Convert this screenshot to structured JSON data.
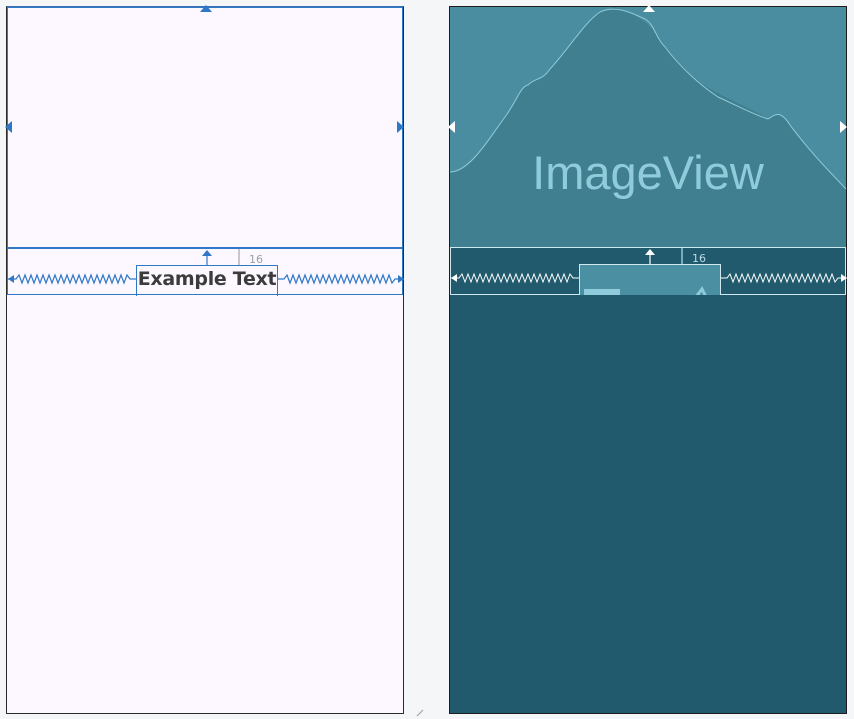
{
  "design_view": {
    "textview": {
      "text": "Example Text"
    },
    "top_margin": "16",
    "colors": {
      "constraint": "#2f78c7",
      "background": "#fdf8ff",
      "text": "#3c3c3c"
    }
  },
  "blueprint_view": {
    "imageview": {
      "label": "ImageView"
    },
    "top_margin": "16",
    "colors": {
      "background": "#215a6d",
      "image_fill": "#3f7f8f",
      "outline": "#cfe7ee",
      "label": "#8fcbdb"
    }
  }
}
